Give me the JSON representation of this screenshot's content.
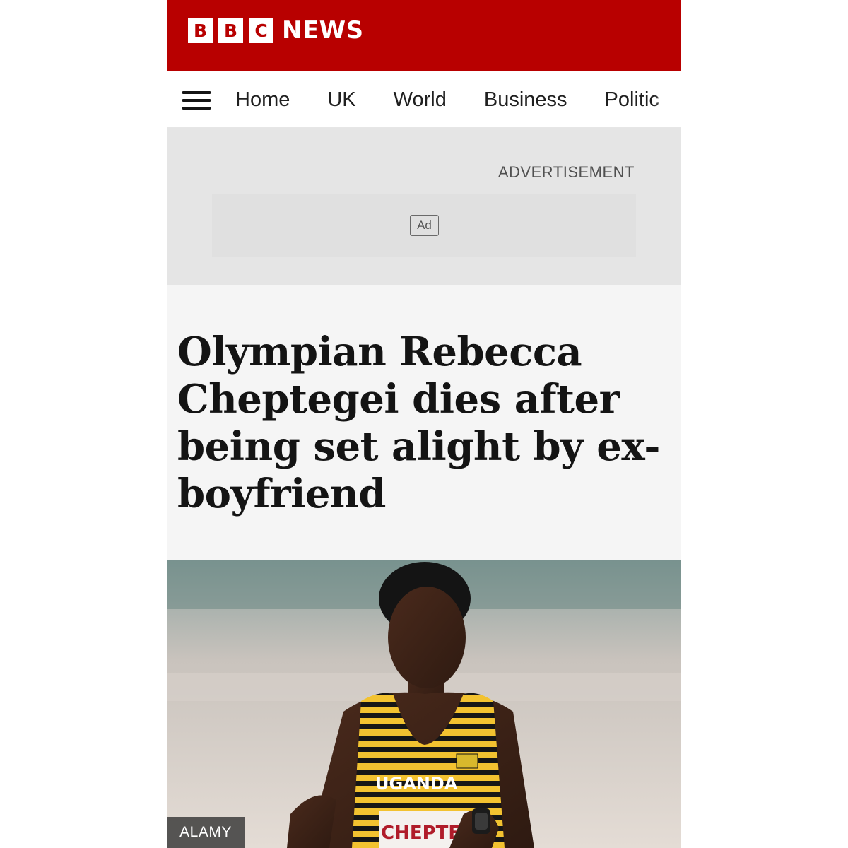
{
  "brand": {
    "letters": [
      "B",
      "B",
      "C"
    ],
    "word": "NEWS",
    "color": "#b80000"
  },
  "nav": {
    "menu_icon": "hamburger-menu-icon",
    "items": [
      "Home",
      "UK",
      "World",
      "Business",
      "Politic"
    ]
  },
  "ad": {
    "label": "ADVERTISEMENT",
    "badge": "Ad"
  },
  "article": {
    "headline": "Olympian Rebecca Cheptegei dies after being set alight by ex-boyfriend"
  },
  "photo": {
    "credit": "ALAMY",
    "vest_text_top": "UGANDA",
    "bib_text": "CHEPTEGEI"
  }
}
